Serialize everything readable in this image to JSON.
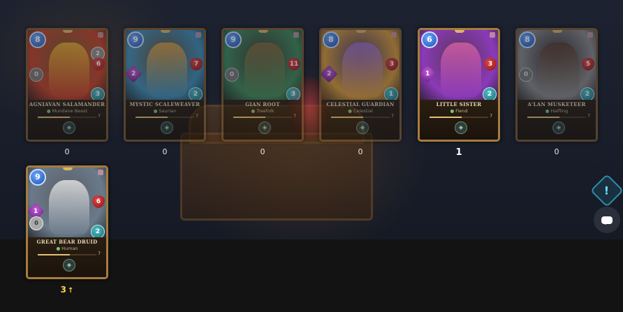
{
  "cards": [
    {
      "name": "AGNIAVAN SALAMANDER",
      "type": "Mundane Beast",
      "mana": "8",
      "health": "6",
      "speed": "3",
      "armor": "2",
      "attack": "",
      "noattack": "0",
      "level": "7",
      "count": "0",
      "art_color": "#c0402a",
      "figure_color": "#e8b030",
      "dim": true
    },
    {
      "name": "MYSTIC SCALEWEAVER",
      "type": "Saurian",
      "mana": "9",
      "health": "7",
      "speed": "2",
      "attack": "2",
      "level": "7",
      "count": "0",
      "art_color": "#3f8fb8",
      "figure_color": "#e0a040",
      "dim": true
    },
    {
      "name": "GIAN ROOT",
      "type": "Treefolk",
      "mana": "9",
      "health": "11",
      "speed": "3",
      "noattack": "0",
      "level": "7",
      "count": "0",
      "art_color": "#3f8a5a",
      "figure_color": "#8a6a3a",
      "dim": true
    },
    {
      "name": "CELESTIAL GUARDIAN",
      "type": "Celestial",
      "mana": "8",
      "health": "3",
      "speed": "1",
      "attack": "2",
      "level": "7",
      "count": "0",
      "art_color": "#d89a3a",
      "figure_color": "#a070d0",
      "dim": true
    },
    {
      "name": "LITTLE SISTER",
      "type": "Fiend",
      "mana": "6",
      "health": "3",
      "speed": "2",
      "attack": "1",
      "level": "7",
      "count": "1",
      "art_color": "#8a3ab8",
      "figure_color": "#d05fa0",
      "dim": false
    },
    {
      "name": "A'LAN MUSKETEER",
      "type": "Halfling",
      "mana": "8",
      "health": "5",
      "speed": "2",
      "noattack": "0",
      "level": "7",
      "count": "0",
      "art_color": "#8a8a8a",
      "figure_color": "#5a3a2a",
      "dim": true
    },
    {
      "name": "GREAT BEAR DRUID",
      "type": "Human",
      "mana": "9",
      "health": "6",
      "speed": "2",
      "attack": "1",
      "ranged": "0",
      "level": "7",
      "count": "3",
      "count_arrow": "↑",
      "art_color": "#6a7a8a",
      "figure_color": "#e0e0e0",
      "dim": false
    }
  ],
  "ui": {
    "info_icon": "!",
    "colors": {
      "card_border": "#7a5a33",
      "count_gold": "#ffd54a",
      "info_accent": "#2d8fa5"
    }
  }
}
